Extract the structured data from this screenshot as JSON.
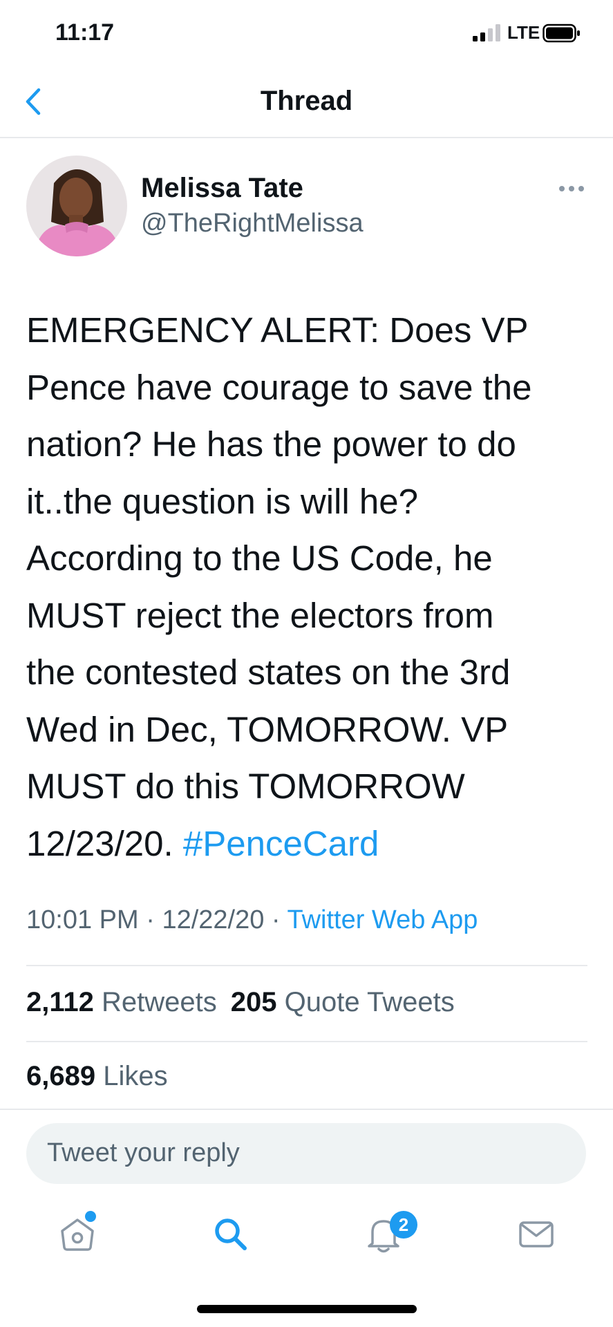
{
  "status_bar": {
    "time": "11:17",
    "network": "LTE"
  },
  "navbar": {
    "title": "Thread"
  },
  "author": {
    "name": "Melissa Tate",
    "handle": "@TheRightMelissa"
  },
  "tweet": {
    "text": "EMERGENCY ALERT:  Does VP\nPence have courage to save the\nnation?  He has the power to do\nit..the question is will he?\nAccording to the US Code, he\nMUST reject the  electors from\nthe contested states on the 3rd\nWed in Dec, TOMORROW.  VP\nMUST do this TOMORROW\n12/23/20.  ",
    "hashtag": "#PenceCard",
    "time": "10:01 PM",
    "date": "12/22/20",
    "separator": "·",
    "source": "Twitter Web App"
  },
  "stats": {
    "retweets_count": "2,112",
    "retweets_label": "Retweets",
    "quotes_count": "205",
    "quotes_label": "Quote Tweets",
    "likes_count": "6,689",
    "likes_label": "Likes"
  },
  "reply_box": {
    "placeholder": "Tweet your reply"
  },
  "tab_bar": {
    "notifications_badge": "2",
    "icons": [
      "home-icon",
      "search-icon",
      "notifications-icon",
      "messages-icon"
    ]
  },
  "colors": {
    "accent": "#1d9bf0",
    "text": "#0f1419",
    "secondary": "#536471",
    "divider": "#e7e9ec"
  }
}
